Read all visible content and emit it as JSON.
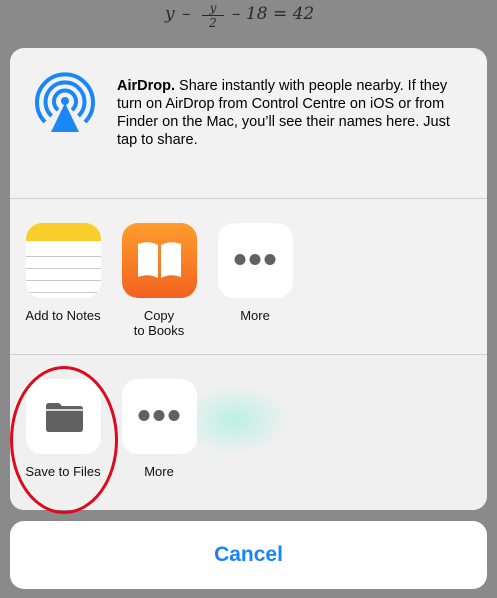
{
  "background": {
    "equation": "y -  y  - 18 = 42",
    "frac_num": "y",
    "frac_den": "2"
  },
  "airdrop": {
    "title": "AirDrop.",
    "description": " Share instantly with people nearby. If they turn on AirDrop from Control Centre on iOS or from Finder on the Mac, you’ll see their names here. Just tap to share."
  },
  "apps": [
    {
      "label": "Add to Notes",
      "icon": "notes-icon"
    },
    {
      "label": "Copy\nto Books",
      "icon": "books-icon"
    },
    {
      "label": "More",
      "icon": "more-dots-icon"
    }
  ],
  "actions": [
    {
      "label": "Save to Files",
      "icon": "folder-icon"
    },
    {
      "label": "More",
      "icon": "more-dots-icon"
    }
  ],
  "cancel_label": "Cancel",
  "colors": {
    "accent": "#1a84f7",
    "annotation": "#dd0a1e",
    "notes_yellow": "#f9cd2b",
    "books_orange": "#f47b22"
  }
}
